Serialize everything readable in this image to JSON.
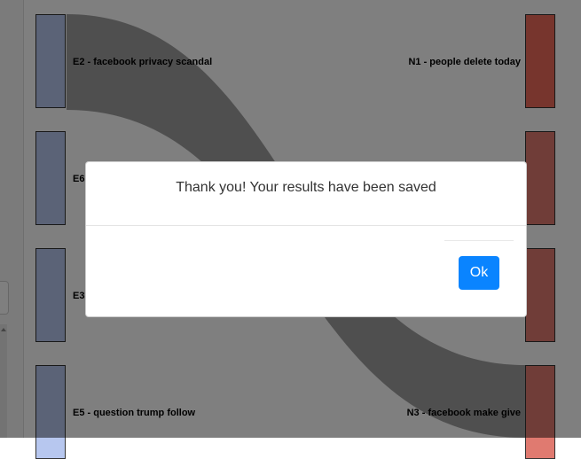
{
  "sankey": {
    "left_nodes": [
      {
        "label": "E2 - facebook privacy scandal"
      },
      {
        "label": "E6"
      },
      {
        "label": "E3"
      },
      {
        "label": "E5 - question trump follow"
      }
    ],
    "right_nodes": [
      {
        "label": "N1 - people delete today"
      },
      {
        "label": ""
      },
      {
        "label": ""
      },
      {
        "label": "N3 - facebook make give"
      }
    ]
  },
  "modal": {
    "message": "Thank you! Your results have been saved",
    "ok_label": "Ok"
  },
  "colors": {
    "left_node": "#b7c7ef",
    "right_node": "#e07a70",
    "right_node_top": "#ee6a5a",
    "link": "#9a9a9a",
    "ok_button": "#0a84ff",
    "backdrop": "rgba(0,0,0,0.5)"
  }
}
